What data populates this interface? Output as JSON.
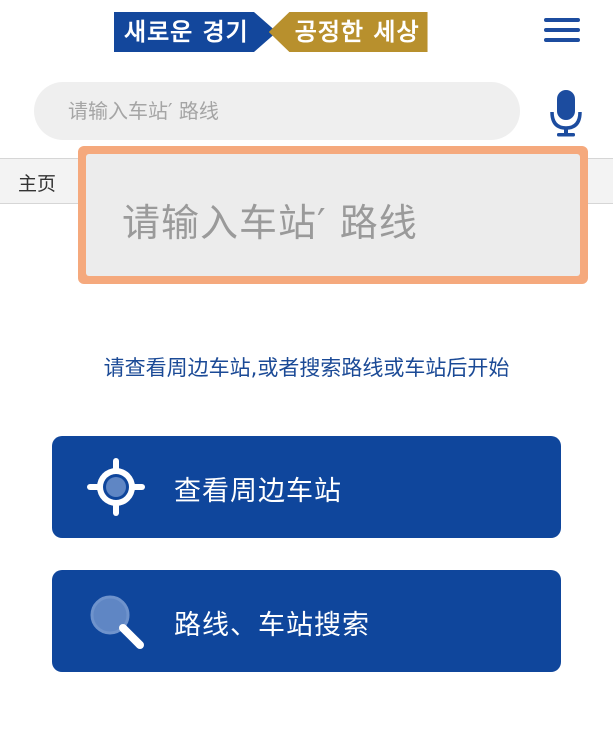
{
  "header": {
    "logo_left_text": "새로운 경기",
    "logo_right_text": "공정한 세상",
    "menu_icon": "hamburger-menu-icon"
  },
  "search": {
    "placeholder": "请输入车站′ 路线",
    "value": "",
    "mic_icon": "microphone-icon"
  },
  "tabs": {
    "home_label": "主页"
  },
  "zoom_tooltip": {
    "text": "请输入车站′ 路线"
  },
  "main": {
    "hint": "请查看周边车站,或者搜索路线或车站后开始",
    "buttons": [
      {
        "label": "查看周边车站",
        "icon": "location-target-icon"
      },
      {
        "label": "路线、车站搜索",
        "icon": "magnifier-icon"
      }
    ]
  },
  "colors": {
    "brand_blue": "#0f469c",
    "logo_gold": "#b8902d",
    "tooltip_border": "#f5a97d",
    "hint_text": "#1b4a96"
  }
}
